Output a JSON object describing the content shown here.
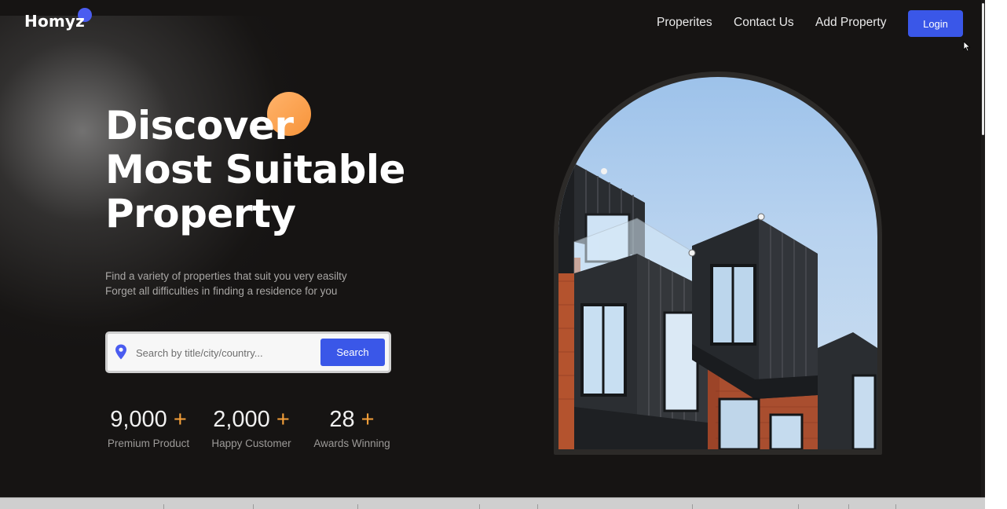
{
  "brand": {
    "name": "Homyz",
    "accent": "#4a5cf0"
  },
  "nav": {
    "items": [
      {
        "label": "Properites"
      },
      {
        "label": "Contact Us"
      },
      {
        "label": "Add Property"
      }
    ],
    "login_label": "Login"
  },
  "hero": {
    "title_lines": [
      "Discover",
      "Most Suitable",
      "Property"
    ],
    "subtitle_lines": [
      "Find a variety of properties that suit you very easilty",
      "Forget all difficulties in finding a residence for you"
    ],
    "search": {
      "placeholder": "Search by title/city/country...",
      "value": "",
      "button_label": "Search"
    },
    "stats": [
      {
        "value": "9,000",
        "plus": "+",
        "label": "Premium Product"
      },
      {
        "value": "2,000",
        "plus": "+",
        "label": "Happy Customer"
      },
      {
        "value": "28",
        "plus": "+",
        "label": "Awards Winning"
      }
    ],
    "image": {
      "alt": "modern apartment building"
    }
  },
  "colors": {
    "primary_button": "#3a57e8",
    "orange_accent": "#f7943a",
    "background": "#161413"
  },
  "icons": [
    "location-pin-icon",
    "mouse-cursor-icon"
  ]
}
